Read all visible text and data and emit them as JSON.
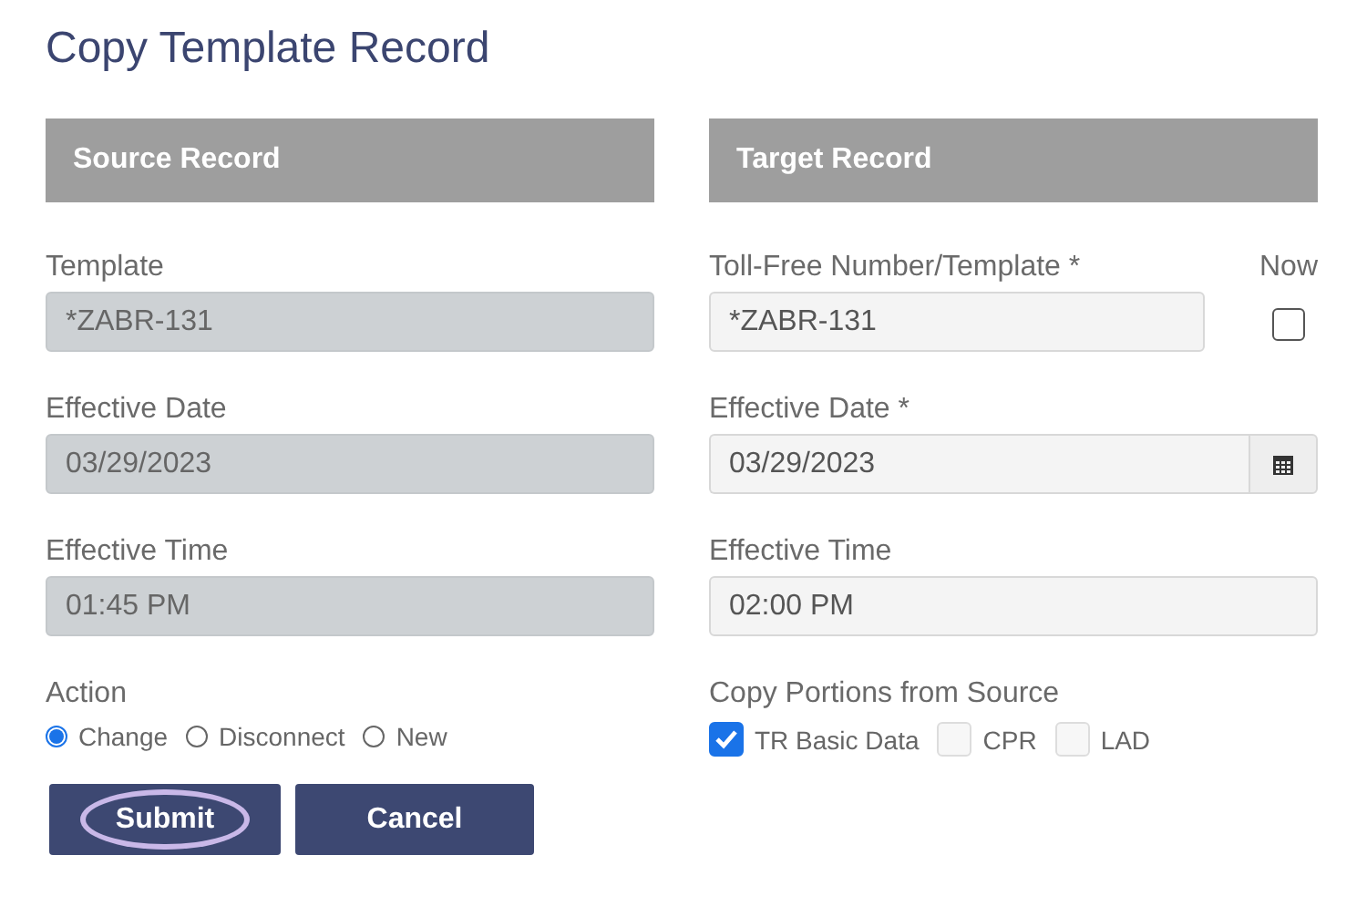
{
  "title": "Copy Template Record",
  "source": {
    "header": "Source Record",
    "fields": [
      {
        "label": "Template",
        "value": "*ZABR-131",
        "disabled": true
      },
      {
        "label": "Effective Date",
        "value": "03/29/2023",
        "disabled": true
      },
      {
        "label": "Effective Time",
        "value": "01:45 PM",
        "disabled": true
      }
    ],
    "action": {
      "label": "Action",
      "options": [
        {
          "label": "Change",
          "selected": true
        },
        {
          "label": "Disconnect",
          "selected": false
        },
        {
          "label": "New",
          "selected": false
        }
      ]
    }
  },
  "target": {
    "header": "Target Record",
    "fields": [
      {
        "label": "Toll-Free Number/Template *",
        "value": "*ZABR-131",
        "kind": "text",
        "disabled": false
      },
      {
        "label": "Effective Date *",
        "value": "03/29/2023",
        "kind": "date",
        "disabled": false
      },
      {
        "label": "Effective Time",
        "value": "02:00 PM",
        "kind": "text",
        "disabled": false
      }
    ],
    "now": {
      "label": "Now",
      "checked": false
    },
    "portions": {
      "label": "Copy Portions from Source",
      "options": [
        {
          "label": "TR Basic Data",
          "checked": true
        },
        {
          "label": "CPR",
          "checked": false
        },
        {
          "label": "LAD",
          "checked": false
        }
      ]
    }
  },
  "buttons": [
    {
      "label": "Submit",
      "focused": true
    },
    {
      "label": "Cancel",
      "focused": false
    }
  ]
}
